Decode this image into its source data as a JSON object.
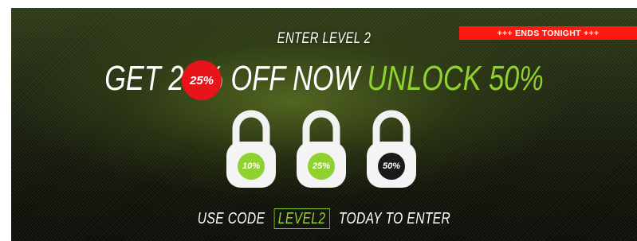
{
  "banner": {
    "level_text": "ENTER LEVEL 2",
    "ribbon_text": "+++ ENDS TONIGHT +++",
    "headline": {
      "part1": "GET",
      "struck": "25",
      "part2": "% OFF NOW",
      "unlock": "UNLOCK 50%"
    },
    "burst_text": "25%",
    "locks": [
      {
        "label": "10%",
        "color": "#8fd12e"
      },
      {
        "label": "25%",
        "color": "#8fd12e"
      },
      {
        "label": "50%",
        "color": "#1a1a1a"
      }
    ],
    "footer": {
      "before": "USE CODE",
      "code": "LEVEL2",
      "after": "TODAY TO ENTER"
    },
    "colors": {
      "accent_green": "#8fd12e",
      "ribbon_red": "#ff1a10"
    }
  }
}
